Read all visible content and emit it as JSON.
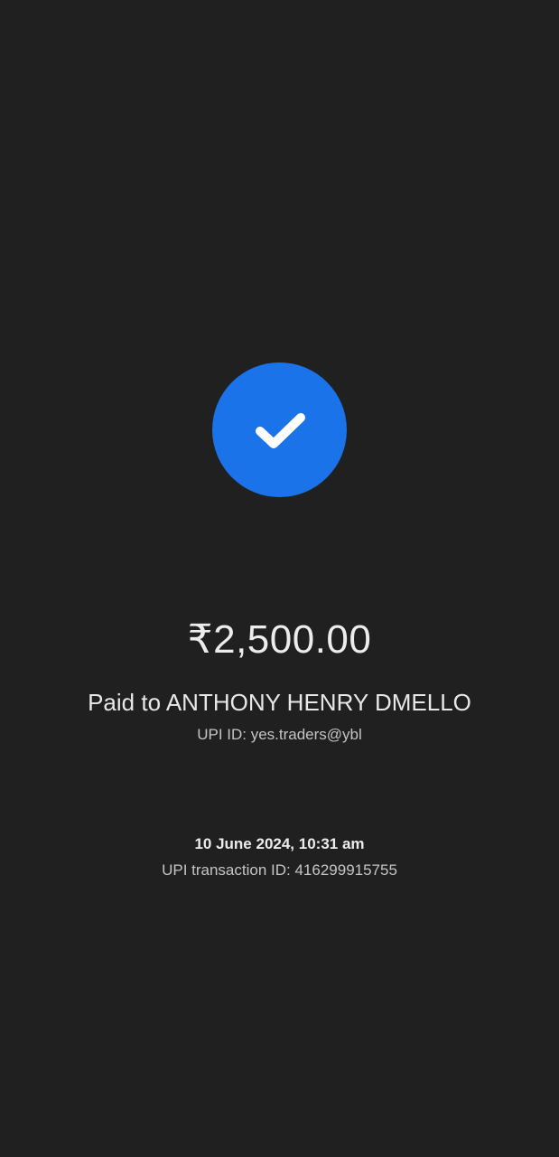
{
  "status": {
    "icon": "check-icon",
    "accent_color": "#1a73e8"
  },
  "payment": {
    "amount": "₹2,500.00",
    "paid_to": "Paid to ANTHONY HENRY DMELLO",
    "upi_id": "UPI ID: yes.traders@ybl"
  },
  "transaction": {
    "datetime": "10 June 2024, 10:31 am",
    "upi_transaction_id": "UPI transaction ID: 416299915755"
  }
}
